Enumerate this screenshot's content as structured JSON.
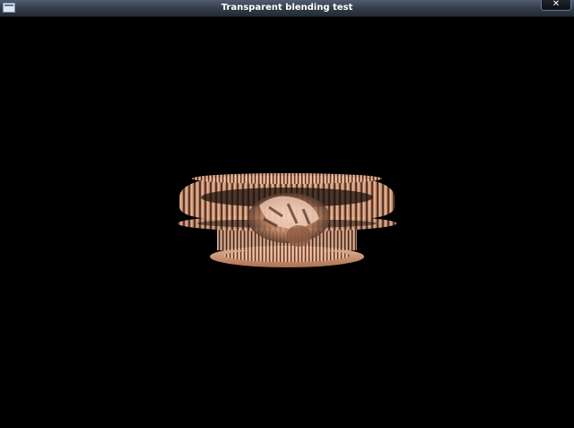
{
  "window": {
    "title": "Transparent blending test",
    "close_glyph": "✕",
    "icons": {
      "app": "app-window-icon",
      "close": "close-icon"
    }
  },
  "viewport": {
    "background": "#000000",
    "object": {
      "name": "blended-torus-object",
      "texture_tones": [
        "#c98b67",
        "#f1c1a2",
        "#5b3b2e",
        "#e7a784"
      ]
    }
  }
}
